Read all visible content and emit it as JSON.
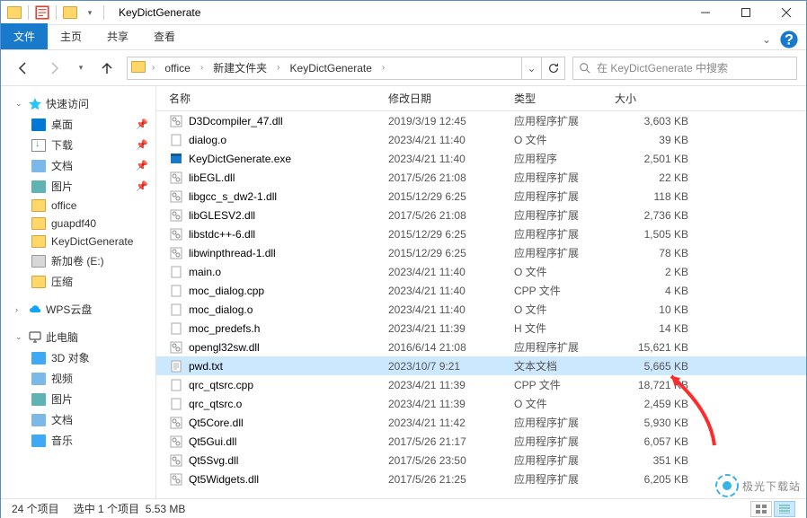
{
  "title": "KeyDictGenerate",
  "ribbon": {
    "file": "文件",
    "home": "主页",
    "share": "共享",
    "view": "查看"
  },
  "breadcrumb": {
    "seg1": "office",
    "seg2": "新建文件夹",
    "seg3": "KeyDictGenerate"
  },
  "search": {
    "placeholder": "在 KeyDictGenerate 中搜索"
  },
  "sidebar": {
    "quick": "快速访问",
    "quick_items": [
      {
        "label": "桌面",
        "ico": "ico-desktop",
        "pin": true
      },
      {
        "label": "下载",
        "ico": "ico-downloads",
        "pin": true
      },
      {
        "label": "文档",
        "ico": "ico-doc",
        "pin": true
      },
      {
        "label": "图片",
        "ico": "ico-pic",
        "pin": true
      },
      {
        "label": "office",
        "ico": "ico-folder",
        "pin": false
      },
      {
        "label": "guapdf40",
        "ico": "ico-folder",
        "pin": false
      },
      {
        "label": "KeyDictGenerate",
        "ico": "ico-folder",
        "pin": false
      },
      {
        "label": "新加卷 (E:)",
        "ico": "ico-drive",
        "pin": false
      },
      {
        "label": "压缩",
        "ico": "ico-folder",
        "pin": false
      }
    ],
    "wps": "WPS云盘",
    "pc": "此电脑",
    "pc_items": [
      {
        "label": "3D 对象",
        "ico": "ico-3d"
      },
      {
        "label": "视频",
        "ico": "ico-video"
      },
      {
        "label": "图片",
        "ico": "ico-pic"
      },
      {
        "label": "文档",
        "ico": "ico-doc"
      },
      {
        "label": "音乐",
        "ico": "ico-music"
      }
    ]
  },
  "cols": {
    "name": "名称",
    "date": "修改日期",
    "type": "类型",
    "size": "大小"
  },
  "files": [
    {
      "name": "D3Dcompiler_47.dll",
      "date": "2019/3/19 12:45",
      "type": "应用程序扩展",
      "size": "3,603 KB",
      "icon": "dll"
    },
    {
      "name": "dialog.o",
      "date": "2023/4/21 11:40",
      "type": "O 文件",
      "size": "39 KB",
      "icon": "file"
    },
    {
      "name": "KeyDictGenerate.exe",
      "date": "2023/4/21 11:40",
      "type": "应用程序",
      "size": "2,501 KB",
      "icon": "exe"
    },
    {
      "name": "libEGL.dll",
      "date": "2017/5/26 21:08",
      "type": "应用程序扩展",
      "size": "22 KB",
      "icon": "dll"
    },
    {
      "name": "libgcc_s_dw2-1.dll",
      "date": "2015/12/29 6:25",
      "type": "应用程序扩展",
      "size": "118 KB",
      "icon": "dll"
    },
    {
      "name": "libGLESV2.dll",
      "date": "2017/5/26 21:08",
      "type": "应用程序扩展",
      "size": "2,736 KB",
      "icon": "dll"
    },
    {
      "name": "libstdc++-6.dll",
      "date": "2015/12/29 6:25",
      "type": "应用程序扩展",
      "size": "1,505 KB",
      "icon": "dll"
    },
    {
      "name": "libwinpthread-1.dll",
      "date": "2015/12/29 6:25",
      "type": "应用程序扩展",
      "size": "78 KB",
      "icon": "dll"
    },
    {
      "name": "main.o",
      "date": "2023/4/21 11:40",
      "type": "O 文件",
      "size": "2 KB",
      "icon": "file"
    },
    {
      "name": "moc_dialog.cpp",
      "date": "2023/4/21 11:40",
      "type": "CPP 文件",
      "size": "4 KB",
      "icon": "file"
    },
    {
      "name": "moc_dialog.o",
      "date": "2023/4/21 11:40",
      "type": "O 文件",
      "size": "10 KB",
      "icon": "file"
    },
    {
      "name": "moc_predefs.h",
      "date": "2023/4/21 11:39",
      "type": "H 文件",
      "size": "14 KB",
      "icon": "file"
    },
    {
      "name": "opengl32sw.dll",
      "date": "2016/6/14 21:08",
      "type": "应用程序扩展",
      "size": "15,621 KB",
      "icon": "dll"
    },
    {
      "name": "pwd.txt",
      "date": "2023/10/7 9:21",
      "type": "文本文档",
      "size": "5,665 KB",
      "icon": "txt",
      "selected": true
    },
    {
      "name": "qrc_qtsrc.cpp",
      "date": "2023/4/21 11:39",
      "type": "CPP 文件",
      "size": "18,721 KB",
      "icon": "file"
    },
    {
      "name": "qrc_qtsrc.o",
      "date": "2023/4/21 11:39",
      "type": "O 文件",
      "size": "2,459 KB",
      "icon": "file"
    },
    {
      "name": "Qt5Core.dll",
      "date": "2023/4/21 11:42",
      "type": "应用程序扩展",
      "size": "5,930 KB",
      "icon": "dll"
    },
    {
      "name": "Qt5Gui.dll",
      "date": "2017/5/26 21:17",
      "type": "应用程序扩展",
      "size": "6,057 KB",
      "icon": "dll"
    },
    {
      "name": "Qt5Svg.dll",
      "date": "2017/5/26 23:50",
      "type": "应用程序扩展",
      "size": "351 KB",
      "icon": "dll"
    },
    {
      "name": "Qt5Widgets.dll",
      "date": "2017/5/26 21:25",
      "type": "应用程序扩展",
      "size": "6,205 KB",
      "icon": "dll"
    }
  ],
  "status": {
    "items": "24 个项目",
    "selected": "选中 1 个项目",
    "size": "5.53 MB"
  },
  "watermark": "极光下载站"
}
